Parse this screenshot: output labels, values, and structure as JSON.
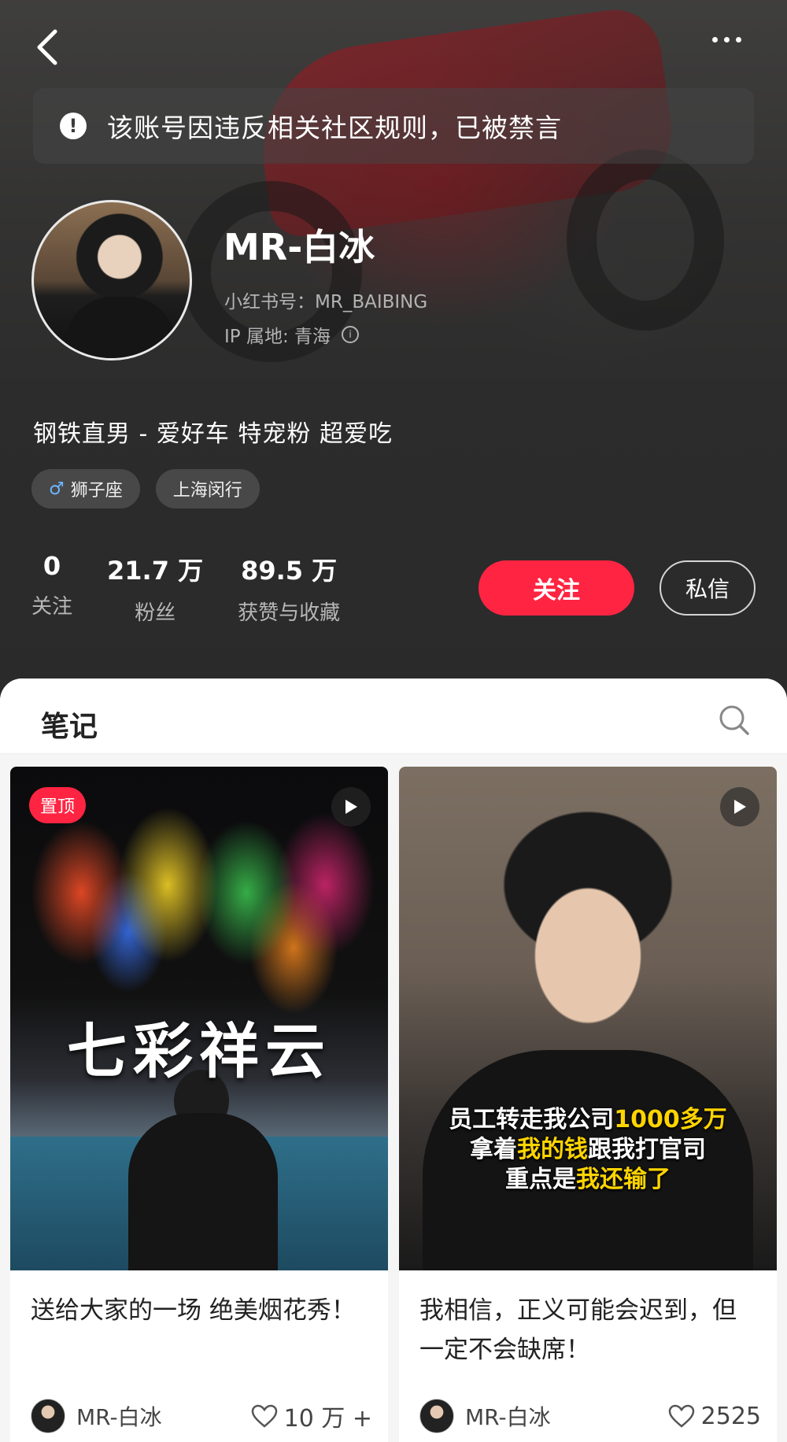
{
  "header": {
    "ban_notice": "该账号因违反相关社区规则，已被禁言",
    "nickname": "MR-白冰",
    "red_id": "小红书号：MR_BAIBING",
    "ip_location": "IP 属地: 青海",
    "bio": "钢铁直男 - 爱好车 特宠粉 超爱吃",
    "tags": [
      {
        "icon": "male-icon",
        "label": "狮子座"
      },
      {
        "label": "上海闵行"
      }
    ],
    "stats": [
      {
        "value": "0",
        "label": "关注"
      },
      {
        "value": "21.7 万",
        "label": "粉丝"
      },
      {
        "value": "89.5 万",
        "label": "获赞与收藏"
      }
    ],
    "follow_label": "关注",
    "message_label": "私信"
  },
  "content": {
    "tab_label": "笔记",
    "notes": [
      {
        "pinned_label": "置顶",
        "cover_text": "七彩祥云",
        "title": "送给大家的一场 绝美烟花秀！",
        "author": "MR-白冰",
        "likes": "10 万 +"
      },
      {
        "cover_caption": [
          "员工转走我公司1000多万",
          "拿着我的钱跟我打官司",
          "重点是我还输了"
        ],
        "title": "我相信，正义可能会迟到，但一定不会缺席！",
        "author": "MR-白冰",
        "likes": "2525"
      }
    ]
  },
  "colors": {
    "accent": "#ff2442",
    "header_bg": "#333232",
    "highlight_yellow": "#ffd400"
  }
}
